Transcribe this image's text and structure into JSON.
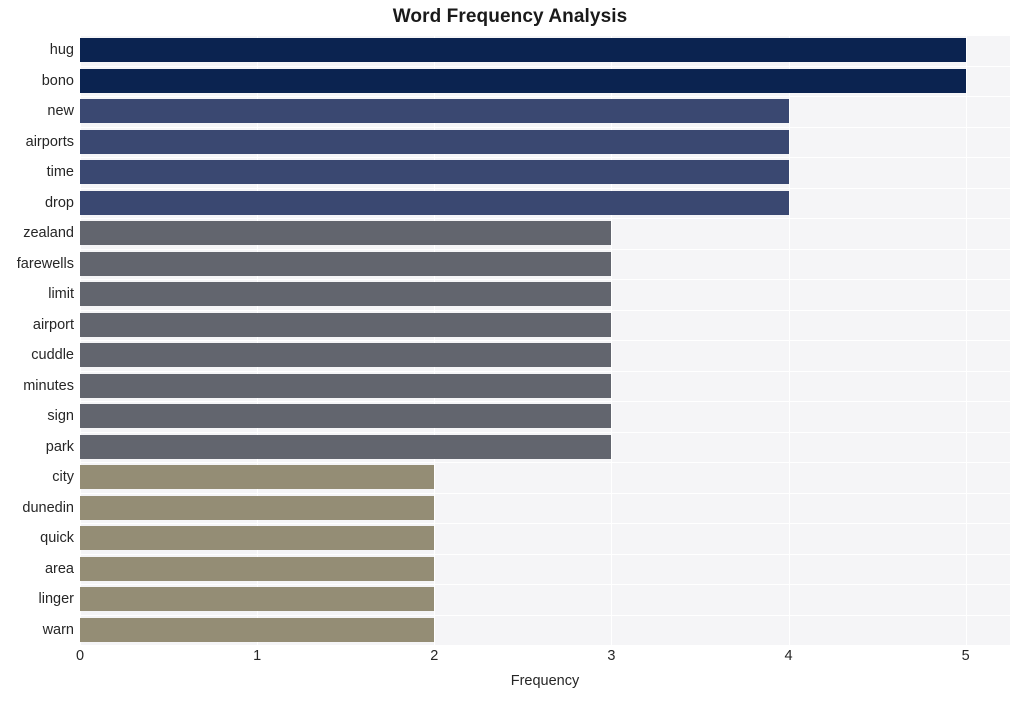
{
  "chart_data": {
    "type": "bar",
    "orientation": "horizontal",
    "title": "Word Frequency Analysis",
    "xlabel": "Frequency",
    "ylabel": "",
    "categories": [
      "hug",
      "bono",
      "new",
      "airports",
      "time",
      "drop",
      "zealand",
      "farewells",
      "limit",
      "airport",
      "cuddle",
      "minutes",
      "sign",
      "park",
      "city",
      "dunedin",
      "quick",
      "area",
      "linger",
      "warn"
    ],
    "values": [
      5,
      5,
      4,
      4,
      4,
      4,
      3,
      3,
      3,
      3,
      3,
      3,
      3,
      3,
      2,
      2,
      2,
      2,
      2,
      2
    ],
    "bar_colors": [
      "#0b2350",
      "#0b2350",
      "#3a4871",
      "#3a4871",
      "#3a4871",
      "#3a4871",
      "#62656e",
      "#62656e",
      "#62656e",
      "#62656e",
      "#62656e",
      "#62656e",
      "#62656e",
      "#62656e",
      "#948d75",
      "#948d75",
      "#948d75",
      "#948d75",
      "#948d75",
      "#948d75"
    ],
    "xlim": [
      0,
      5.25
    ],
    "xticks": [
      0,
      1,
      2,
      3,
      4,
      5
    ],
    "xtick_labels": [
      "0",
      "1",
      "2",
      "3",
      "4",
      "5"
    ],
    "grid": true,
    "grid_color": "#ffffff",
    "plot_background": "#f5f5f7",
    "figure_background": "#ffffff",
    "legend": null
  }
}
